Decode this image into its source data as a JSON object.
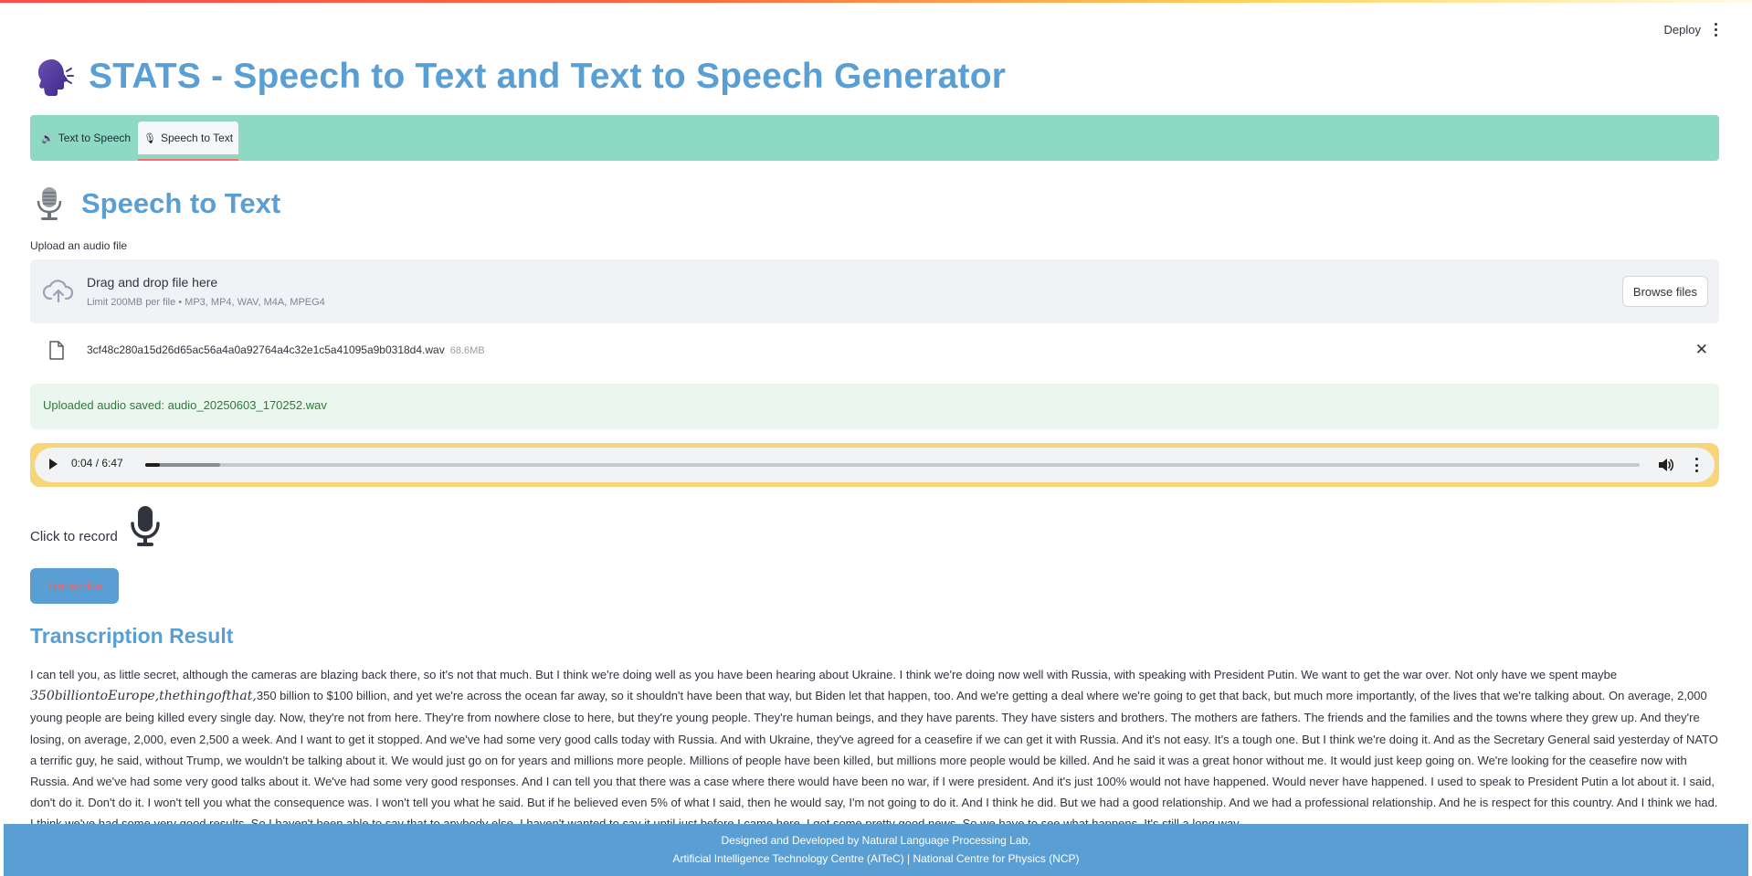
{
  "header": {
    "deploy_label": "Deploy",
    "menu_icon": "kebab-menu-icon"
  },
  "app": {
    "title": "STATS - Speech to Text and Text to Speech Generator",
    "icon": "speaking-head-icon"
  },
  "tabs": [
    {
      "label": "Text to Speech",
      "icon": "speaker-icon",
      "selected": false
    },
    {
      "label": "Speech to Text",
      "icon": "microphone-icon",
      "selected": true
    }
  ],
  "section": {
    "title": "Speech to Text",
    "icon": "studio-microphone-icon"
  },
  "uploader": {
    "label": "Upload an audio file",
    "drop_title": "Drag and drop file here",
    "limit": "Limit 200MB per file • MP3, MP4, WAV, M4A, MPEG4",
    "browse_label": "Browse files",
    "file": {
      "name": "3cf48c280a15d26d65ac56a4a0a92764a4c32e1c5a41095a9b0318d4.wav",
      "size": "68.6MB"
    }
  },
  "success_message": "Uploaded audio saved: audio_20250603_170252.wav",
  "player": {
    "time": "0:04 / 6:47",
    "progress": 0.0098
  },
  "record": {
    "label": "Click to record"
  },
  "transcribe_label": "Transcribe",
  "result": {
    "title": "Transcription Result",
    "text_before": "I can tell you, as little secret, although the cameras are blazing back there, so it's not that much. But I think we're doing well as you have been hearing about Ukraine. I think we're doing now well with Russia, with speaking with President Putin. We want to get the war over. Not only have we spent maybe ",
    "text_math": "350billiontoEurope,thethingofthat,",
    "text_after": "350 billion to $100 billion, and yet we're across the ocean far away, so it shouldn't have been that way, but Biden let that happen, too. And we're getting a deal where we're going to get that back, but much more importantly, of the lives that we're talking about. On average, 2,000 young people are being killed every single day. Now, they're not from here. They're from nowhere close to here, but they're young people. They're human beings, and they have parents. They have sisters and brothers. The mothers are fathers. The friends and the families and the towns where they grew up. And they're losing, on average, 2,000, even 2,500 a week. And I want to get it stopped. And we've had some very good calls today with Russia. And with Ukraine, they've agreed for a ceasefire if we can get it with Russia. And it's not easy. It's a tough one. But I think we're doing it. And as the Secretary General said yesterday of NATO a terrific guy, he said, without Trump, we wouldn't be talking about it. We would just go on for years and millions more people. Millions of people have been killed, but millions more people would be killed. And he said it was a great honor without me. It would just keep going on. We're looking for the ceasefire now with Russia. And we've had some very good talks about it. We've had some very good responses. And I can tell you that there was a case where there would have been no war, if I were president. And it's just 100% would not have happened. Would never have happened. I used to speak to President Putin a lot about it. I said, don't do it. Don't do it. I won't tell you what the consequence was. I won't tell you what he said. But if he believed even 5% of what I said, then he would say, I'm not going to do it. And I think he did. But we had a good relationship. And we had a professional relationship. And he is respect for this country. And I think we had. I think we've had some very good results. So I haven't been able to say that to anybody else. I haven't wanted to say it until just before I came here. I got some pretty good news. So we have to see what happens. It's still a long way"
  },
  "footer": {
    "line1": "Designed and Developed by Natural Language Processing Lab,",
    "line2": "Artificial Intelligence Technology Centre (AITeC) | National Centre for Physics (NCP)"
  },
  "colors": {
    "accent": "#5a9fd4",
    "tab_bar": "#8dd9c3",
    "success_bg": "#ebf7ee",
    "audio_border": "#f7d67a"
  }
}
